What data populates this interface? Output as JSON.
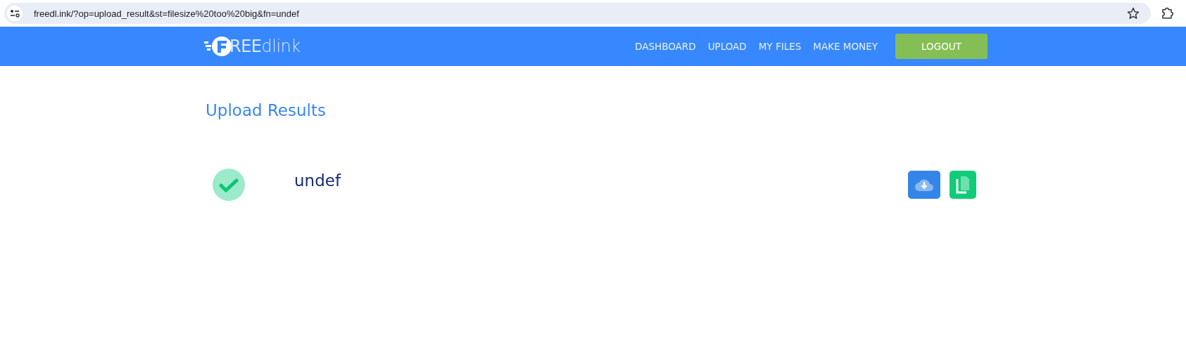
{
  "browser": {
    "url": "freedl.ink/?op=upload_result&st=filesize%20too%20big&fn=undef"
  },
  "header": {
    "logo": "**REE**dlink",
    "nav": [
      "DASHBOARD",
      "UPLOAD",
      "MY FILES",
      "MAKE MONEY"
    ],
    "logout": "LOGOUT"
  },
  "page": {
    "title": "Upload Results"
  },
  "results": [
    {
      "filename": "undef",
      "ok": true
    }
  ]
}
